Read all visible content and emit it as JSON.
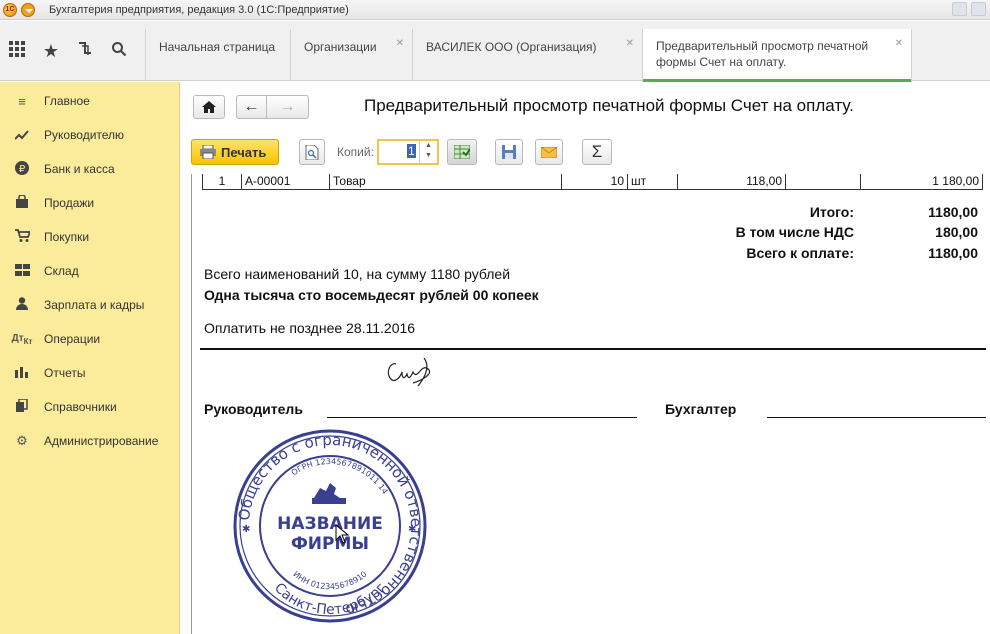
{
  "titlebar": {
    "title": "Бухгалтерия предприятия, редакция 3.0  (1С:Предприятие)"
  },
  "tabs": [
    {
      "label": "Начальная страница"
    },
    {
      "label": "Организации"
    },
    {
      "label": "ВАСИЛЕК ООО (Организация)"
    },
    {
      "label_line1": "Предварительный просмотр печатной",
      "label_line2": "формы Счет на оплату."
    }
  ],
  "sidebar": {
    "items": [
      {
        "label": "Главное",
        "icon": "menu-icon"
      },
      {
        "label": "Руководителю",
        "icon": "trend-icon"
      },
      {
        "label": "Банк и касса",
        "icon": "ruble-icon"
      },
      {
        "label": "Продажи",
        "icon": "bag-icon"
      },
      {
        "label": "Покупки",
        "icon": "cart-icon"
      },
      {
        "label": "Склад",
        "icon": "warehouse-icon"
      },
      {
        "label": "Зарплата и кадры",
        "icon": "person-icon"
      },
      {
        "label": "Операции",
        "icon": "operations-icon"
      },
      {
        "label": "Отчеты",
        "icon": "bar-chart-icon"
      },
      {
        "label": "Справочники",
        "icon": "books-icon"
      },
      {
        "label": "Администрирование",
        "icon": "gear-icon"
      }
    ]
  },
  "page": {
    "title": "Предварительный просмотр печатной формы Счет на оплату."
  },
  "toolbar": {
    "print_label": "Печать",
    "copies_label": "Копий:",
    "copies_value": "1",
    "sum_label": "Σ"
  },
  "invoice": {
    "row": {
      "num": "1",
      "code": "А-00001",
      "name": "Товар",
      "qty": "10",
      "unit": "шт",
      "price": "118,00",
      "sum": "1 180,00"
    },
    "totals": [
      {
        "label": "Итого:",
        "value": "1180,00"
      },
      {
        "label": "В том числе НДС",
        "value": "180,00"
      },
      {
        "label": "Всего к оплате:",
        "value": "1180,00"
      }
    ],
    "summary": "Всего наименований 10, на сумму 1180 рублей",
    "amount_words": "Одна тысяча сто восемьдесят рублей 00 копеек",
    "pay_by": "Оплатить не позднее 28.11.2016",
    "director_label": "Руководитель",
    "accountant_label": "Бухгалтер"
  },
  "stamp": {
    "outer_text": "Общество с ограниченной ответственностью",
    "ogrn": "ОГРН 1234567891011 14",
    "inn": "ИНН 012345678910",
    "city": "Санкт-Петербург",
    "name_line1": "НАЗВАНИЕ",
    "name_line2": "ФИРМЫ",
    "color": "#3a3f8f"
  }
}
